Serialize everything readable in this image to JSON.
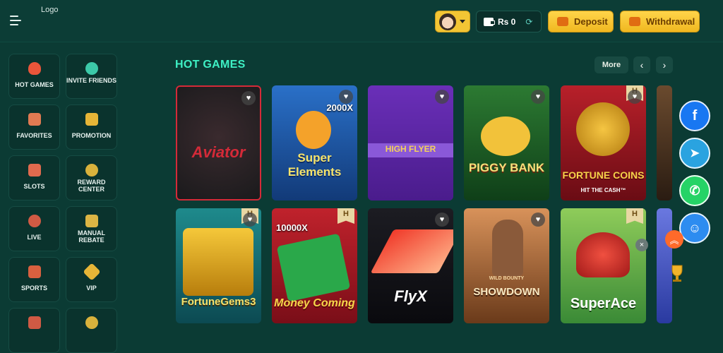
{
  "header": {
    "logo_text": "Logo",
    "balance": "Rs 0",
    "deposit_label": "Deposit",
    "withdrawal_label": "Withdrawal"
  },
  "sidebar": {
    "items": [
      {
        "label": "HOT GAMES",
        "icon": "flame-icon"
      },
      {
        "label": "INVITE FRIENDS",
        "icon": "friends-icon"
      },
      {
        "label": "FAVORITES",
        "icon": "favorites-icon"
      },
      {
        "label": "PROMOTION",
        "icon": "gift-icon"
      },
      {
        "label": "SLOTS",
        "icon": "slots-icon"
      },
      {
        "label": "REWARD CENTER",
        "icon": "medal-icon"
      },
      {
        "label": "LIVE",
        "icon": "live-icon"
      },
      {
        "label": "MANUAL REBATE",
        "icon": "rebate-icon"
      },
      {
        "label": "SPORTS",
        "icon": "sports-icon"
      },
      {
        "label": "VIP",
        "icon": "diamond-icon"
      }
    ]
  },
  "section": {
    "title": "HOT GAMES",
    "more_label": "More"
  },
  "games": [
    {
      "title": "Aviator",
      "sub": ""
    },
    {
      "title": "Super Elements",
      "sub": "",
      "multiplier": "2000X"
    },
    {
      "title": "HIGH FLYER",
      "sub": ""
    },
    {
      "title": "PIGGY BANK",
      "sub": ""
    },
    {
      "title": "FORTUNE COINS",
      "sub": "HIT THE CASH™"
    },
    {
      "title": "FortuneGems3",
      "sub": ""
    },
    {
      "title": "Money Coming",
      "sub": "",
      "multiplier": "10000X"
    },
    {
      "title": "FlyX",
      "sub": ""
    },
    {
      "title": "SHOWDOWN",
      "sub": "WILD BOUNTY"
    },
    {
      "title": "SuperAce",
      "sub": ""
    }
  ],
  "colors": {
    "background": "#0b3b34",
    "accent": "#3ef0c4",
    "gold": "#f3c534"
  }
}
